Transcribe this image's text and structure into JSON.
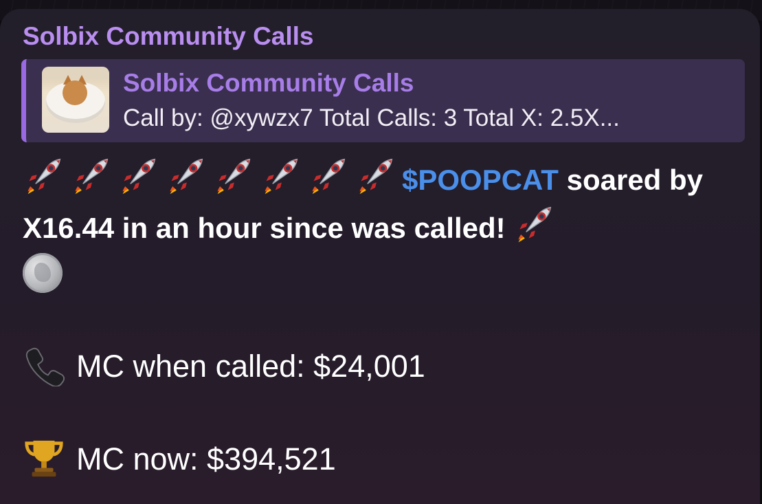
{
  "message": {
    "sender": "Solbix Community Calls",
    "reply": {
      "title": "Solbix Community Calls",
      "text": "Call by: @xywzx7 Total Calls: 3 Total X: 2.5X..."
    },
    "rocket_count": 8,
    "ticker": "$POOPCAT",
    "headline_rest": " soared by X16.44 in an hour since was called!",
    "mc_called_label": "MC when called: $24,001",
    "mc_now_label": "MC now: $394,521"
  },
  "icons": {
    "rocket": "rocket-emoji",
    "coin": "silver-coin-emoji",
    "phone": "telephone-emoji",
    "trophy": "trophy-emoji"
  },
  "colors": {
    "sender": "#b98ef0",
    "reply_bar": "#9a6ae2",
    "ticker": "#4a8fea"
  }
}
